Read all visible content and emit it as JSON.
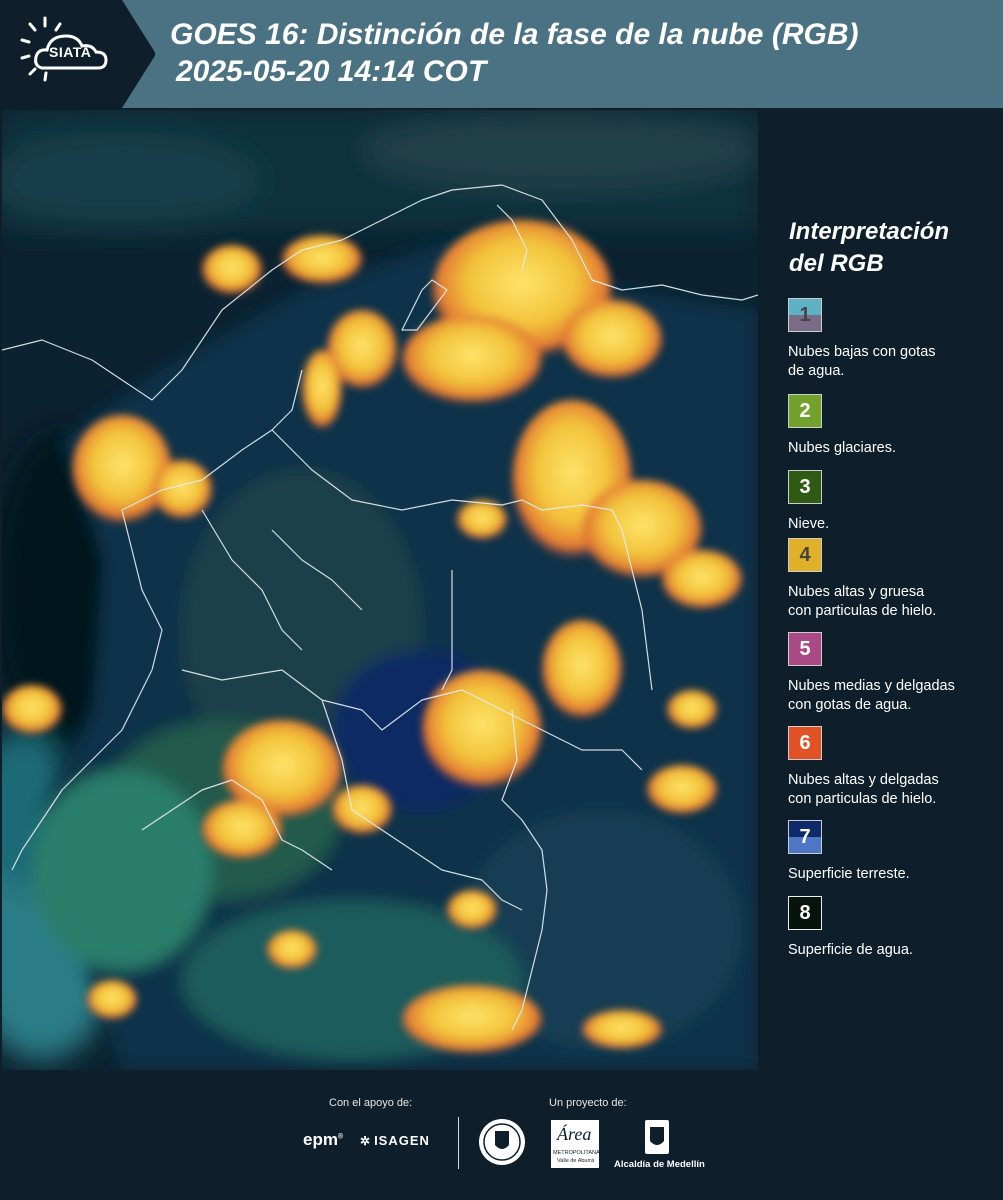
{
  "header": {
    "logo_text": "SIATA",
    "title_line1": "GOES 16: Distinción de la fase de la nube (RGB)",
    "title_line2": "2025-05-20 14:14 COT"
  },
  "legend": {
    "title_line1": "Interpretación",
    "title_line2": "del RGB",
    "items": [
      {
        "number": "1",
        "color_top": "#5fb2c4",
        "color_bottom": "#7a6c86",
        "label_line1": "Nubes bajas con gotas",
        "label_line2": "de agua.",
        "num_color": "#444444"
      },
      {
        "number": "2",
        "color": "#72a12c",
        "label_line1": "Nubes glaciares.",
        "label_line2": "",
        "num_color": "#ffffff"
      },
      {
        "number": "3",
        "color": "#2f5a14",
        "label_line1": "Nieve.",
        "label_line2": "",
        "num_color": "#ffffff"
      },
      {
        "number": "4",
        "color": "#e0b128",
        "label_line1": "Nubes altas y gruesa",
        "label_line2": "con particulas de hielo.",
        "num_color": "#444444"
      },
      {
        "number": "5",
        "color": "#a94a86",
        "label_line1": "Nubes medias y delgadas",
        "label_line2": "con gotas de agua.",
        "num_color": "#ffffff"
      },
      {
        "number": "6",
        "color": "#e25227",
        "label_line1": "Nubes altas y delgadas",
        "label_line2": "con particulas de hielo.",
        "num_color": "#ffffff"
      },
      {
        "number": "7",
        "color_top": "#0f2a6a",
        "color_bottom": "#4d76c4",
        "label_line1": "Superficie terreste.",
        "label_line2": "",
        "num_color": "#ffffff"
      },
      {
        "number": "8",
        "color": "#06140c",
        "label_line1": "Superficie de agua.",
        "label_line2": "",
        "num_color": "#ffffff"
      }
    ]
  },
  "footer": {
    "support_label": "Con el apoyo de:",
    "project_label": "Un proyecto de:",
    "sponsor_epm": "epm",
    "sponsor_isagen": "ISAGEN",
    "amva_name": "Área",
    "amva_sub1": "METROPOLITANA",
    "amva_sub2": "Valle de Aburrá",
    "medellin": "Alcaldía de Medellín"
  }
}
